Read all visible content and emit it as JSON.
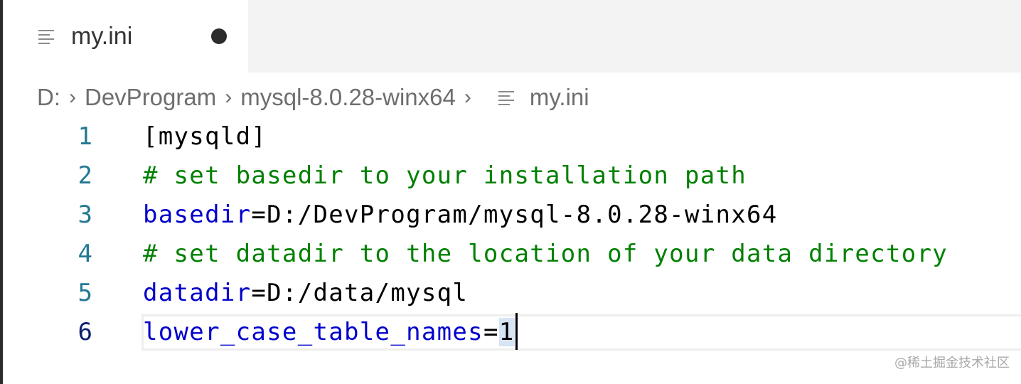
{
  "tab": {
    "title": "my.ini",
    "icon": "file-lines-icon",
    "dirty_indicator": "unsaved-dot"
  },
  "breadcrumb": {
    "items": [
      "D:",
      "DevProgram",
      "mysql-8.0.28-winx64"
    ],
    "separator": "›",
    "file": "my.ini"
  },
  "editor": {
    "lines": [
      {
        "number": "1",
        "bracket": "[mysqld]"
      },
      {
        "number": "2",
        "comment": "# set basedir to your installation path"
      },
      {
        "number": "3",
        "key": "basedir",
        "eq": "=",
        "value": "D:/DevProgram/mysql-8.0.28-winx64"
      },
      {
        "number": "4",
        "comment": "# set datadir to the location of your data directory"
      },
      {
        "number": "5",
        "key": "datadir",
        "eq": "=",
        "value": "D:/data/mysql"
      },
      {
        "number": "6",
        "key": "lower_case_table_names",
        "eq": "=",
        "value": "1"
      }
    ],
    "active_line": 6
  },
  "watermark": "@稀土掘金技术社区",
  "colors": {
    "line_number": "#237893",
    "active_line_number": "#0b216f",
    "comment": "#008000",
    "key": "#0000cc",
    "breadcrumb_text": "#6e6e6e",
    "tabbar_bg": "#f3f3f3"
  }
}
